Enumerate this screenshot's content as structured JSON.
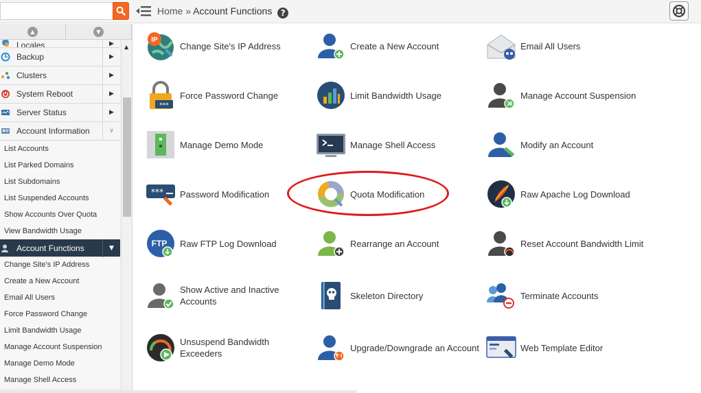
{
  "search": {
    "value": "",
    "placeholder": ""
  },
  "breadcrumb": {
    "home": "Home",
    "separator": "»",
    "current": "Account Functions"
  },
  "sidebar": {
    "categories_top": [
      {
        "label": "Locales",
        "icon": "locales-icon"
      },
      {
        "label": "Backup",
        "icon": "backup-icon"
      },
      {
        "label": "Clusters",
        "icon": "clusters-icon"
      },
      {
        "label": "System Reboot",
        "icon": "reboot-icon"
      },
      {
        "label": "Server Status",
        "icon": "server-status-icon"
      },
      {
        "label": "Account Information",
        "icon": "account-information-icon"
      }
    ],
    "account_information_items": [
      "List Accounts",
      "List Parked Domains",
      "List Subdomains",
      "List Suspended Accounts",
      "Show Accounts Over Quota",
      "View Bandwidth Usage"
    ],
    "active_category": {
      "label": "Account Functions",
      "icon": "account-functions-icon"
    },
    "account_functions_items": [
      "Change Site's IP Address",
      "Create a New Account",
      "Email All Users",
      "Force Password Change",
      "Limit Bandwidth Usage",
      "Manage Account Suspension",
      "Manage Demo Mode",
      "Manage Shell Access"
    ]
  },
  "features": [
    {
      "label": "Change Site's IP Address",
      "icon": "ip-address-icon"
    },
    {
      "label": "Create a New Account",
      "icon": "create-account-icon"
    },
    {
      "label": "Email All Users",
      "icon": "email-users-icon"
    },
    {
      "label": "Force Password Change",
      "icon": "padlock-icon"
    },
    {
      "label": "Limit Bandwidth Usage",
      "icon": "bandwidth-chart-icon"
    },
    {
      "label": "Manage Account Suspension",
      "icon": "suspension-user-icon"
    },
    {
      "label": "Manage Demo Mode",
      "icon": "demo-mode-icon"
    },
    {
      "label": "Manage Shell Access",
      "icon": "terminal-icon"
    },
    {
      "label": "Modify an Account",
      "icon": "modify-account-icon"
    },
    {
      "label": "Password Modification",
      "icon": "password-field-icon"
    },
    {
      "label": "Quota Modification",
      "icon": "quota-donut-icon"
    },
    {
      "label": "Raw Apache Log Download",
      "icon": "apache-feather-icon"
    },
    {
      "label": "Raw FTP Log Download",
      "icon": "ftp-download-icon"
    },
    {
      "label": "Rearrange an Account",
      "icon": "rearrange-account-icon"
    },
    {
      "label": "Reset Account Bandwidth Limit",
      "icon": "reset-bandwidth-icon"
    },
    {
      "label": "Show Active and Inactive Accounts",
      "icon": "active-inactive-icon"
    },
    {
      "label": "Skeleton Directory",
      "icon": "skeleton-book-icon"
    },
    {
      "label": "Terminate Accounts",
      "icon": "terminate-accounts-icon"
    },
    {
      "label": "Unsuspend Bandwidth Exceeders",
      "icon": "speedometer-icon"
    },
    {
      "label": "Upgrade/Downgrade an Account",
      "icon": "upgrade-account-icon"
    },
    {
      "label": "Web Template Editor",
      "icon": "web-template-icon"
    }
  ],
  "colors": {
    "accent_orange": "#f26722",
    "sidebar_active_bg": "#293a4a",
    "highlight_ring": "#e0191c"
  }
}
